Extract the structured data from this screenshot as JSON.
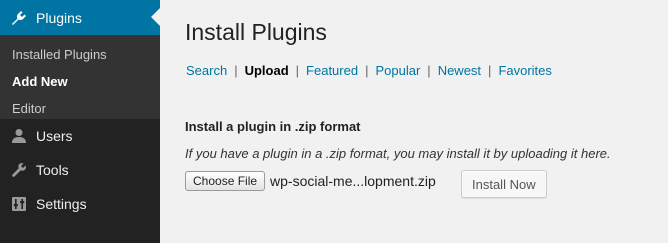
{
  "colors": {
    "sidebar_bg": "#222222",
    "submenu_bg": "#333333",
    "active_menu_bg": "#0074a2",
    "link": "#0074a2",
    "content_bg": "#f1f1f1"
  },
  "sidebar": {
    "active_menu": {
      "label": "Plugins",
      "icon": "plugin-icon"
    },
    "submenu": [
      {
        "label": "Installed Plugins"
      },
      {
        "label": "Add New",
        "current": true
      },
      {
        "label": "Editor"
      }
    ],
    "items": [
      {
        "label": "Users",
        "icon": "users-icon"
      },
      {
        "label": "Tools",
        "icon": "wrench-icon"
      },
      {
        "label": "Settings",
        "icon": "settings-icon"
      }
    ]
  },
  "main": {
    "title": "Install Plugins",
    "tabs": [
      {
        "label": "Search"
      },
      {
        "label": "Upload",
        "current": true
      },
      {
        "label": "Featured"
      },
      {
        "label": "Popular"
      },
      {
        "label": "Newest"
      },
      {
        "label": "Favorites"
      }
    ],
    "separator": "|",
    "upload": {
      "heading": "Install a plugin in .zip format",
      "help": "If you have a plugin in a .zip format, you may install it by uploading it here.",
      "choose_file_label": "Choose File",
      "file_name": "wp-social-me...lopment.zip",
      "install_label": "Install Now"
    }
  }
}
